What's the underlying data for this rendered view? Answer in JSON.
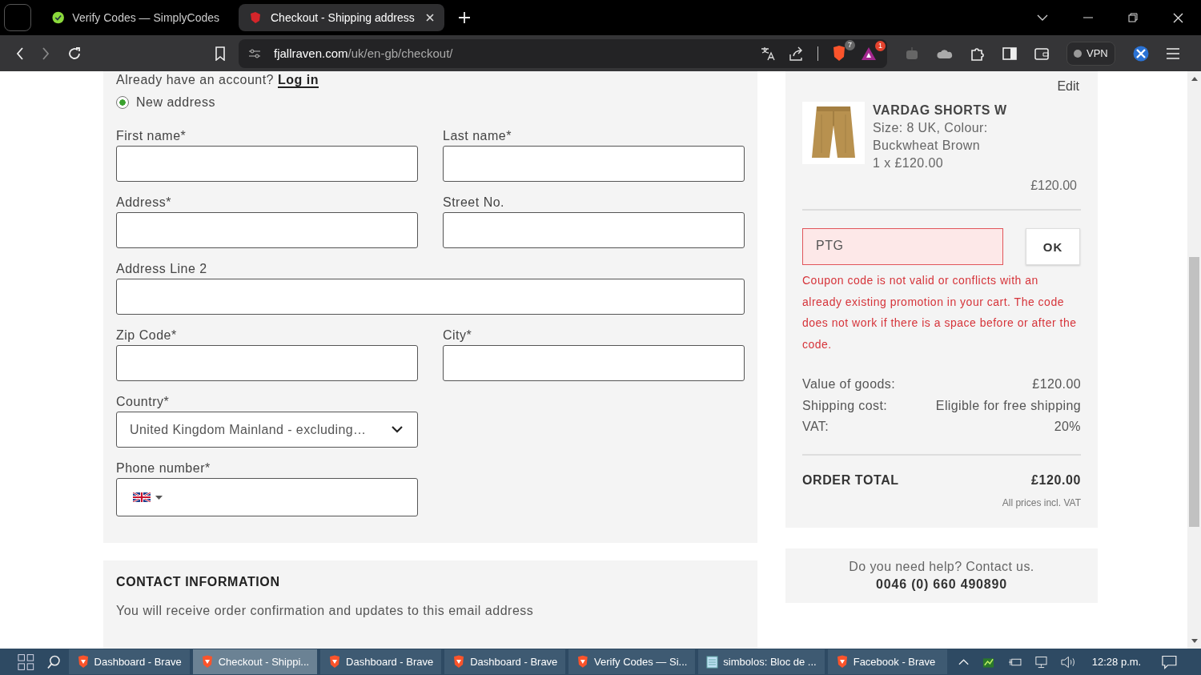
{
  "browser": {
    "tabs": [
      {
        "title": "Verify Codes — SimplyCodes",
        "kind": "check",
        "selected": false
      },
      {
        "title": "Checkout - Shipping address",
        "kind": "fox",
        "selected": true
      }
    ],
    "address": {
      "domain": "fjallraven.com",
      "path": "/uk/en-gb/checkout/"
    },
    "shields_count": "7",
    "rewards_count": "1",
    "vpn_label": "VPN"
  },
  "form": {
    "account_prompt": "Already have an account?",
    "login_link": "Log in",
    "address_option": {
      "label": "New address",
      "selected": true
    },
    "rows": [
      [
        {
          "label": "First name*",
          "kind": "text"
        },
        {
          "label": "Last name*",
          "kind": "text"
        }
      ],
      [
        {
          "label": "Address*",
          "kind": "text"
        },
        {
          "label": "Street No.",
          "kind": "text"
        }
      ],
      [
        {
          "label": "Address Line 2",
          "kind": "text"
        }
      ],
      [
        {
          "label": "Zip Code*",
          "kind": "text"
        },
        {
          "label": "City*",
          "kind": "text"
        }
      ],
      [
        {
          "label": "Country*",
          "kind": "select",
          "value": "United Kingdom Mainland - excluding…"
        }
      ],
      [
        {
          "label": "Phone number*",
          "kind": "phone"
        }
      ]
    ]
  },
  "contact": {
    "heading": "CONTACT INFORMATION",
    "text": "You will receive order confirmation and updates to this email address"
  },
  "summary": {
    "edit": "Edit",
    "product": {
      "name": "VARDAG SHORTS W",
      "details": "Size:  8 UK,  Colour: Buckwheat Brown",
      "quantity": "1 x £120.00",
      "line_total": "£120.00"
    },
    "coupon": {
      "value": "PTG",
      "error": true,
      "button": "OK",
      "message": "Coupon code is not valid or conflicts with an already existing promotion in your cart. The code does not work if there is a space before or after the code."
    },
    "totals": [
      {
        "label": "Value of goods:",
        "value": "£120.00"
      },
      {
        "label": "Shipping cost:",
        "value": "Eligible for free shipping"
      },
      {
        "label": "VAT:",
        "value": "20%"
      }
    ],
    "order_total": {
      "label": "ORDER TOTAL",
      "value": "£120.00"
    },
    "note": "All prices incl. VAT"
  },
  "help": {
    "text": "Do you need help? Contact us.",
    "phone": "0046 (0) 660 490890"
  },
  "taskbar": {
    "items": [
      {
        "title": "Dashboard - Brave",
        "kind": "brave",
        "selected": false
      },
      {
        "title": "Checkout - Shippi...",
        "kind": "brave",
        "selected": true
      },
      {
        "title": "Dashboard - Brave",
        "kind": "brave",
        "selected": false
      },
      {
        "title": "Dashboard - Brave",
        "kind": "brave",
        "selected": false
      },
      {
        "title": "Verify Codes — Si...",
        "kind": "brave",
        "selected": false
      },
      {
        "title": "simbolos: Bloc de ...",
        "kind": "notepad",
        "selected": false
      },
      {
        "title": "Facebook - Brave",
        "kind": "brave",
        "selected": false
      }
    ],
    "time": "12:28 p.m."
  }
}
